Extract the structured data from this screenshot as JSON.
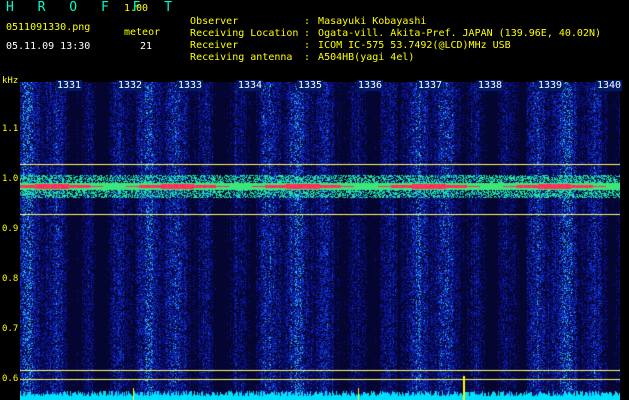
{
  "app": {
    "title": "H R O F F T",
    "version": "1.00"
  },
  "file": {
    "name": "0511091330.png",
    "datetime": "05.11.09 13:30"
  },
  "meteor": {
    "label": "meteor",
    "count": "21"
  },
  "info": [
    {
      "key": "Observer",
      "value": "Masayuki Kobayashi"
    },
    {
      "key": "Receiving Location",
      "value": "Ogata-vill. Akita-Pref. JAPAN (139.96E, 40.02N)"
    },
    {
      "key": "Receiver",
      "value": "ICOM IC-575 53.7492(@LCD)MHz USB"
    },
    {
      "key": "Receiving antenna",
      "value": "A504HB(yagi 4el)"
    }
  ],
  "axis": {
    "y_unit": "kHz",
    "y_ticks": [
      "1.1",
      "1.0",
      "0.9",
      "0.8",
      "0.7",
      "0.6"
    ],
    "x_ticks": [
      "1331",
      "1332",
      "1333",
      "1334",
      "1335",
      "1336",
      "1337",
      "1338",
      "1339",
      "1340"
    ]
  },
  "colors": {
    "header_yellow": "#ffff00",
    "title_cyan": "#00ffc8",
    "echo_red": "#ff2060",
    "noise_blue": "#1020c0"
  }
}
